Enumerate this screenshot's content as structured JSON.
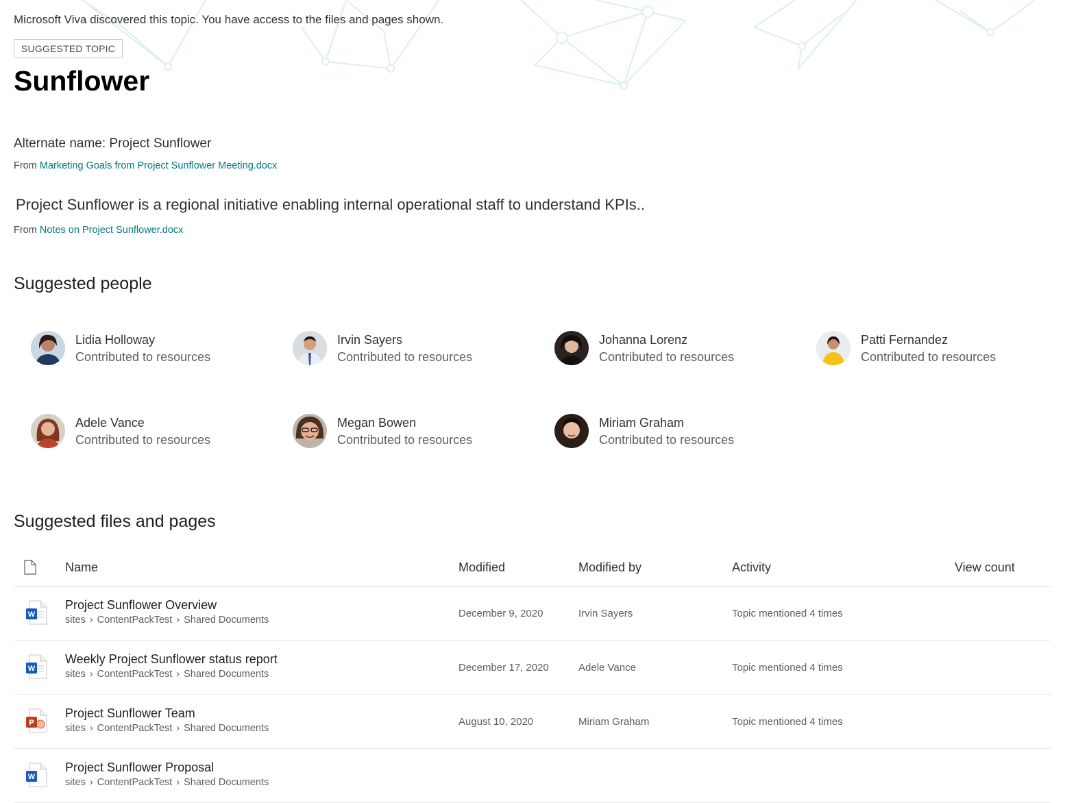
{
  "banner": "Microsoft Viva discovered this topic. You have access to the files and pages shown.",
  "tag": "SUGGESTED TOPIC",
  "title": "Sunflower",
  "alternate_name": "Alternate name: Project Sunflower",
  "alt_source": {
    "prefix": "From",
    "link": "Marketing Goals from Project Sunflower Meeting.docx"
  },
  "description": "Project Sunflower is a regional initiative enabling internal operational staff to understand KPIs..",
  "desc_source": {
    "prefix": "From",
    "link": "Notes on Project Sunflower.docx"
  },
  "suggested_people": {
    "heading": "Suggested people",
    "people": [
      {
        "name": "Lidia Holloway",
        "role": "Contributed to resources"
      },
      {
        "name": "Irvin Sayers",
        "role": "Contributed to resources"
      },
      {
        "name": "Johanna Lorenz",
        "role": "Contributed to resources"
      },
      {
        "name": "Patti Fernandez",
        "role": "Contributed to resources"
      },
      {
        "name": "Adele Vance",
        "role": "Contributed to resources"
      },
      {
        "name": "Megan Bowen",
        "role": "Contributed to resources"
      },
      {
        "name": "Miriam Graham",
        "role": "Contributed to resources"
      }
    ]
  },
  "suggested_files": {
    "heading": "Suggested files and pages",
    "columns": {
      "name": "Name",
      "modified": "Modified",
      "modified_by": "Modified by",
      "activity": "Activity",
      "view_count": "View count"
    },
    "rows": [
      {
        "icon": "word-icon",
        "name": "Project Sunflower Overview",
        "path": [
          "sites",
          "ContentPackTest",
          "Shared Documents"
        ],
        "modified": "December 9, 2020",
        "modified_by": "Irvin Sayers",
        "activity": "Topic mentioned 4 times",
        "views": ""
      },
      {
        "icon": "word-icon",
        "name": "Weekly Project Sunflower status report",
        "path": [
          "sites",
          "ContentPackTest",
          "Shared Documents"
        ],
        "modified": "December 17, 2020",
        "modified_by": "Adele Vance",
        "activity": "Topic mentioned 4 times",
        "views": ""
      },
      {
        "icon": "powerpoint-icon",
        "name": "Project Sunflower Team",
        "path": [
          "sites",
          "ContentPackTest",
          "Shared Documents"
        ],
        "modified": "August 10, 2020",
        "modified_by": "Miriam Graham",
        "activity": "Topic mentioned 4 times",
        "views": ""
      },
      {
        "icon": "word-icon",
        "name": "Project Sunflower Proposal",
        "path": [
          "sites",
          "ContentPackTest",
          "Shared Documents"
        ],
        "modified": "",
        "modified_by": "",
        "activity": "",
        "views": ""
      }
    ]
  },
  "colors": {
    "link": "#03787c",
    "word": "#185abd",
    "powerpoint": "#c43e1c",
    "pattern": "#dff0ee"
  }
}
